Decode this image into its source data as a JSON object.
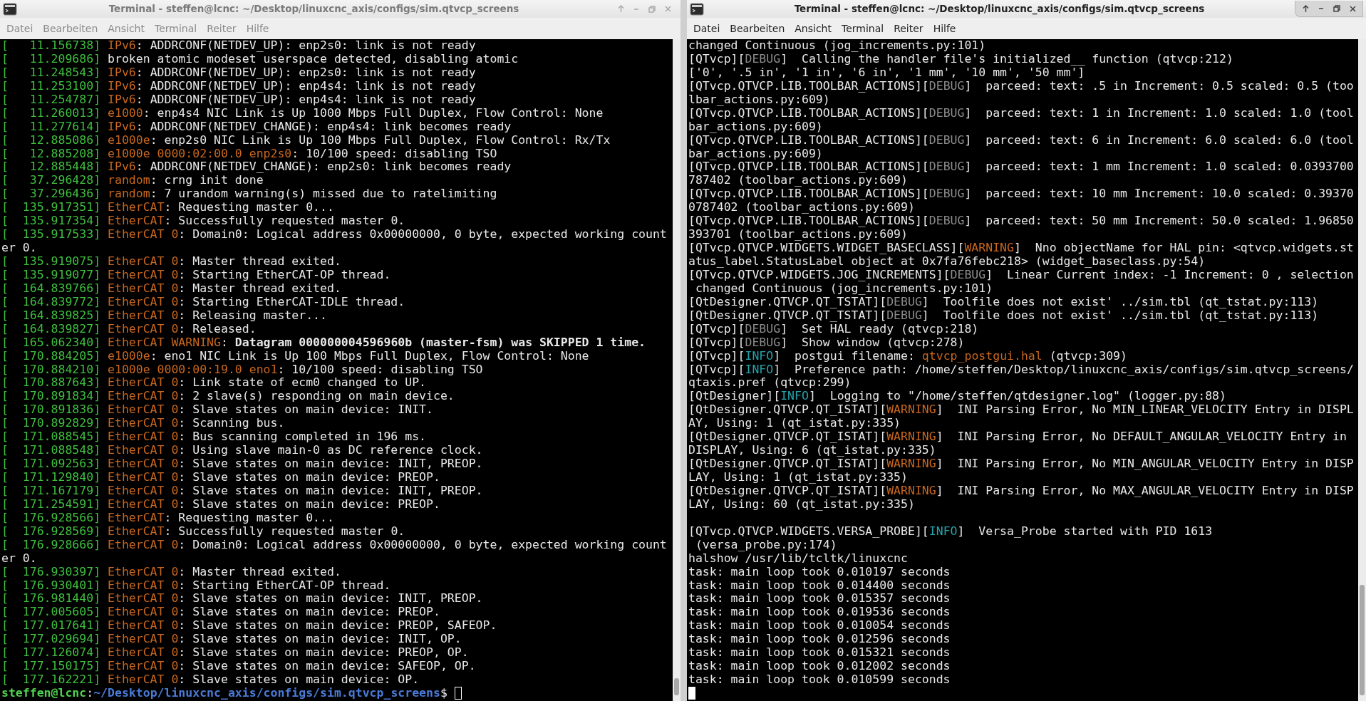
{
  "windows": [
    {
      "title": "Terminal - steffen@lcnc: ~/Desktop/linuxcnc_axis/configs/sim.qtvcp_screens",
      "active": false,
      "menu": [
        "Datei",
        "Bearbeiten",
        "Ansicht",
        "Terminal",
        "Reiter",
        "Hilfe"
      ],
      "lines": [
        [
          {
            "text": "[   11.156738] ",
            "kind": "time"
          },
          {
            "text": "IPv6",
            "kind": "source"
          },
          {
            "text": ": ADDRCONF(NETDEV_UP): enp2s0: link is not ready",
            "kind": "plain"
          }
        ],
        [
          {
            "text": "[   11.209686] ",
            "kind": "time"
          },
          {
            "text": "broken atomic modeset userspace detected, disabling atomic",
            "kind": "plain"
          }
        ],
        [
          {
            "text": "[   11.248543] ",
            "kind": "time"
          },
          {
            "text": "IPv6",
            "kind": "source"
          },
          {
            "text": ": ADDRCONF(NETDEV_UP): enp2s0: link is not ready",
            "kind": "plain"
          }
        ],
        [
          {
            "text": "[   11.253100] ",
            "kind": "time"
          },
          {
            "text": "IPv6",
            "kind": "source"
          },
          {
            "text": ": ADDRCONF(NETDEV_UP): enp4s4: link is not ready",
            "kind": "plain"
          }
        ],
        [
          {
            "text": "[   11.254787] ",
            "kind": "time"
          },
          {
            "text": "IPv6",
            "kind": "source"
          },
          {
            "text": ": ADDRCONF(NETDEV_UP): enp4s4: link is not ready",
            "kind": "plain"
          }
        ],
        [
          {
            "text": "[   11.260013] ",
            "kind": "time"
          },
          {
            "text": "e1000",
            "kind": "source"
          },
          {
            "text": ": enp4s4 NIC Link is Up 1000 Mbps Full Duplex, Flow Control: None",
            "kind": "plain"
          }
        ],
        [
          {
            "text": "[   11.277614] ",
            "kind": "time"
          },
          {
            "text": "IPv6",
            "kind": "source"
          },
          {
            "text": ": ADDRCONF(NETDEV_CHANGE): enp4s4: link becomes ready",
            "kind": "plain"
          }
        ],
        [
          {
            "text": "[   12.885086] ",
            "kind": "time"
          },
          {
            "text": "e1000e",
            "kind": "source"
          },
          {
            "text": ": enp2s0 NIC Link is Up 100 Mbps Full Duplex, Flow Control: Rx/Tx",
            "kind": "plain"
          }
        ],
        [
          {
            "text": "[   12.885208] ",
            "kind": "time"
          },
          {
            "text": "e1000e 0000:02:00.0 enp2s0",
            "kind": "source"
          },
          {
            "text": ": 10/100 speed: disabling TSO",
            "kind": "plain"
          }
        ],
        [
          {
            "text": "[   12.885448] ",
            "kind": "time"
          },
          {
            "text": "IPv6",
            "kind": "source"
          },
          {
            "text": ": ADDRCONF(NETDEV_CHANGE): enp2s0: link becomes ready",
            "kind": "plain"
          }
        ],
        [
          {
            "text": "[   37.296428] ",
            "kind": "time"
          },
          {
            "text": "random",
            "kind": "source"
          },
          {
            "text": ": crng init done",
            "kind": "plain"
          }
        ],
        [
          {
            "text": "[   37.296436] ",
            "kind": "time"
          },
          {
            "text": "random",
            "kind": "source"
          },
          {
            "text": ": 7 urandom warning(s) missed due to ratelimiting",
            "kind": "plain"
          }
        ],
        [
          {
            "text": "[  135.917351] ",
            "kind": "time"
          },
          {
            "text": "EtherCAT",
            "kind": "source"
          },
          {
            "text": ": Requesting master 0...",
            "kind": "plain"
          }
        ],
        [
          {
            "text": "[  135.917354] ",
            "kind": "time"
          },
          {
            "text": "EtherCAT",
            "kind": "source"
          },
          {
            "text": ": Successfully requested master 0.",
            "kind": "plain"
          }
        ],
        [
          {
            "text": "[  135.917533] ",
            "kind": "time"
          },
          {
            "text": "EtherCAT 0",
            "kind": "source"
          },
          {
            "text": ": Domain0: Logical address 0x00000000, 0 byte, expected working count",
            "kind": "plain"
          }
        ],
        [
          {
            "text": "er 0.",
            "kind": "plain"
          }
        ],
        [
          {
            "text": "[  135.919075] ",
            "kind": "time"
          },
          {
            "text": "EtherCAT 0",
            "kind": "source"
          },
          {
            "text": ": Master thread exited.",
            "kind": "plain"
          }
        ],
        [
          {
            "text": "[  135.919077] ",
            "kind": "time"
          },
          {
            "text": "EtherCAT 0",
            "kind": "source"
          },
          {
            "text": ": Starting EtherCAT-OP thread.",
            "kind": "plain"
          }
        ],
        [
          {
            "text": "[  164.839766] ",
            "kind": "time"
          },
          {
            "text": "EtherCAT 0",
            "kind": "source"
          },
          {
            "text": ": Master thread exited.",
            "kind": "plain"
          }
        ],
        [
          {
            "text": "[  164.839772] ",
            "kind": "time"
          },
          {
            "text": "EtherCAT 0",
            "kind": "source"
          },
          {
            "text": ": Starting EtherCAT-IDLE thread.",
            "kind": "plain"
          }
        ],
        [
          {
            "text": "[  164.839825] ",
            "kind": "time"
          },
          {
            "text": "EtherCAT 0",
            "kind": "source"
          },
          {
            "text": ": Releasing master...",
            "kind": "plain"
          }
        ],
        [
          {
            "text": "[  164.839827] ",
            "kind": "time"
          },
          {
            "text": "EtherCAT 0",
            "kind": "source"
          },
          {
            "text": ": Released.",
            "kind": "plain"
          }
        ],
        [
          {
            "text": "[  165.062340] ",
            "kind": "time"
          },
          {
            "text": "EtherCAT WARNING",
            "kind": "source"
          },
          {
            "text": ": **Datagram 000000004596960b (master-fsm) was SKIPPED 1 time.**",
            "kind": "plain"
          }
        ],
        [
          {
            "text": "[  170.884205] ",
            "kind": "time"
          },
          {
            "text": "e1000e",
            "kind": "source"
          },
          {
            "text": ": eno1 NIC Link is Up 100 Mbps Full Duplex, Flow Control: None",
            "kind": "plain"
          }
        ],
        [
          {
            "text": "[  170.884210] ",
            "kind": "time"
          },
          {
            "text": "e1000e 0000:00:19.0 eno1",
            "kind": "source"
          },
          {
            "text": ": 10/100 speed: disabling TSO",
            "kind": "plain"
          }
        ],
        [
          {
            "text": "[  170.887643] ",
            "kind": "time"
          },
          {
            "text": "EtherCAT 0",
            "kind": "source"
          },
          {
            "text": ": Link state of ecm0 changed to UP.",
            "kind": "plain"
          }
        ],
        [
          {
            "text": "[  170.891834] ",
            "kind": "time"
          },
          {
            "text": "EtherCAT 0",
            "kind": "source"
          },
          {
            "text": ": 2 slave(s) responding on main device.",
            "kind": "plain"
          }
        ],
        [
          {
            "text": "[  170.891836] ",
            "kind": "time"
          },
          {
            "text": "EtherCAT 0",
            "kind": "source"
          },
          {
            "text": ": Slave states on main device: INIT.",
            "kind": "plain"
          }
        ],
        [
          {
            "text": "[  170.892829] ",
            "kind": "time"
          },
          {
            "text": "EtherCAT 0",
            "kind": "source"
          },
          {
            "text": ": Scanning bus.",
            "kind": "plain"
          }
        ],
        [
          {
            "text": "[  171.088545] ",
            "kind": "time"
          },
          {
            "text": "EtherCAT 0",
            "kind": "source"
          },
          {
            "text": ": Bus scanning completed in 196 ms.",
            "kind": "plain"
          }
        ],
        [
          {
            "text": "[  171.088548] ",
            "kind": "time"
          },
          {
            "text": "EtherCAT 0",
            "kind": "source"
          },
          {
            "text": ": Using slave main-0 as DC reference clock.",
            "kind": "plain"
          }
        ],
        [
          {
            "text": "[  171.092563] ",
            "kind": "time"
          },
          {
            "text": "EtherCAT 0",
            "kind": "source"
          },
          {
            "text": ": Slave states on main device: INIT, PREOP.",
            "kind": "plain"
          }
        ],
        [
          {
            "text": "[  171.129840] ",
            "kind": "time"
          },
          {
            "text": "EtherCAT 0",
            "kind": "source"
          },
          {
            "text": ": Slave states on main device: PREOP.",
            "kind": "plain"
          }
        ],
        [
          {
            "text": "[  171.167179] ",
            "kind": "time"
          },
          {
            "text": "EtherCAT 0",
            "kind": "source"
          },
          {
            "text": ": Slave states on main device: INIT, PREOP.",
            "kind": "plain"
          }
        ],
        [
          {
            "text": "[  171.254591] ",
            "kind": "time"
          },
          {
            "text": "EtherCAT 0",
            "kind": "source"
          },
          {
            "text": ": Slave states on main device: PREOP.",
            "kind": "plain"
          }
        ],
        [
          {
            "text": "[  176.928566] ",
            "kind": "time"
          },
          {
            "text": "EtherCAT",
            "kind": "source"
          },
          {
            "text": ": Requesting master 0...",
            "kind": "plain"
          }
        ],
        [
          {
            "text": "[  176.928569] ",
            "kind": "time"
          },
          {
            "text": "EtherCAT",
            "kind": "source"
          },
          {
            "text": ": Successfully requested master 0.",
            "kind": "plain"
          }
        ],
        [
          {
            "text": "[  176.928666] ",
            "kind": "time"
          },
          {
            "text": "EtherCAT 0",
            "kind": "source"
          },
          {
            "text": ": Domain0: Logical address 0x00000000, 0 byte, expected working count",
            "kind": "plain"
          }
        ],
        [
          {
            "text": "er 0.",
            "kind": "plain"
          }
        ],
        [
          {
            "text": "[  176.930397] ",
            "kind": "time"
          },
          {
            "text": "EtherCAT 0",
            "kind": "source"
          },
          {
            "text": ": Master thread exited.",
            "kind": "plain"
          }
        ],
        [
          {
            "text": "[  176.930401] ",
            "kind": "time"
          },
          {
            "text": "EtherCAT 0",
            "kind": "source"
          },
          {
            "text": ": Starting EtherCAT-OP thread.",
            "kind": "plain"
          }
        ],
        [
          {
            "text": "[  176.981440] ",
            "kind": "time"
          },
          {
            "text": "EtherCAT 0",
            "kind": "source"
          },
          {
            "text": ": Slave states on main device: INIT, PREOP.",
            "kind": "plain"
          }
        ],
        [
          {
            "text": "[  177.005605] ",
            "kind": "time"
          },
          {
            "text": "EtherCAT 0",
            "kind": "source"
          },
          {
            "text": ": Slave states on main device: PREOP.",
            "kind": "plain"
          }
        ],
        [
          {
            "text": "[  177.017641] ",
            "kind": "time"
          },
          {
            "text": "EtherCAT 0",
            "kind": "source"
          },
          {
            "text": ": Slave states on main device: PREOP, SAFEOP.",
            "kind": "plain"
          }
        ],
        [
          {
            "text": "[  177.029694] ",
            "kind": "time"
          },
          {
            "text": "EtherCAT 0",
            "kind": "source"
          },
          {
            "text": ": Slave states on main device: INIT, OP.",
            "kind": "plain"
          }
        ],
        [
          {
            "text": "[  177.126074] ",
            "kind": "time"
          },
          {
            "text": "EtherCAT 0",
            "kind": "source"
          },
          {
            "text": ": Slave states on main device: PREOP, OP.",
            "kind": "plain"
          }
        ],
        [
          {
            "text": "[  177.150175] ",
            "kind": "time"
          },
          {
            "text": "EtherCAT 0",
            "kind": "source"
          },
          {
            "text": ": Slave states on main device: SAFEOP, OP.",
            "kind": "plain"
          }
        ],
        [
          {
            "text": "[  177.162221] ",
            "kind": "time"
          },
          {
            "text": "EtherCAT 0",
            "kind": "source"
          },
          {
            "text": ": Slave states on main device: OP.",
            "kind": "plain"
          }
        ]
      ],
      "prompt": [
        {
          "text": "steffen@lcnc",
          "kind": "user"
        },
        {
          "text": ":",
          "kind": "plain"
        },
        {
          "text": "~/Desktop/linuxcnc_axis/configs/sim.qtvcp_screens",
          "kind": "path"
        },
        {
          "text": "$",
          "kind": "plain"
        }
      ]
    },
    {
      "title": "Terminal - steffen@lcnc: ~/Desktop/linuxcnc_axis/configs/sim.qtvcp_screens",
      "active": true,
      "menu": [
        "Datei",
        "Bearbeiten",
        "Ansicht",
        "Terminal",
        "Reiter",
        "Hilfe"
      ],
      "lines": [
        [
          {
            "text": "changed Continuous (jog_increments.py:101)",
            "kind": "plain"
          }
        ],
        [
          {
            "text": "[QTvcp][",
            "kind": "plain"
          },
          {
            "text": "DEBUG",
            "kind": "debug"
          },
          {
            "text": "]  Calling the handler file's initialized__ function (qtvcp:212)",
            "kind": "plain"
          }
        ],
        [
          {
            "text": "['0', '.5 in', '1 in', '6 in', '1 mm', '10 mm', '50 mm']",
            "kind": "plain"
          }
        ],
        [
          {
            "text": "[QTvcp.QTVCP.LIB.TOOLBAR_ACTIONS][",
            "kind": "plain"
          },
          {
            "text": "DEBUG",
            "kind": "debug"
          },
          {
            "text": "]  parceed: text: .5 in Increment: 0.5 scaled: 0.5 (too",
            "kind": "plain"
          }
        ],
        [
          {
            "text": "lbar_actions.py:609)",
            "kind": "plain"
          }
        ],
        [
          {
            "text": "[QTvcp.QTVCP.LIB.TOOLBAR_ACTIONS][",
            "kind": "plain"
          },
          {
            "text": "DEBUG",
            "kind": "debug"
          },
          {
            "text": "]  parceed: text: 1 in Increment: 1.0 scaled: 1.0 (tool",
            "kind": "plain"
          }
        ],
        [
          {
            "text": "bar_actions.py:609)",
            "kind": "plain"
          }
        ],
        [
          {
            "text": "[QTvcp.QTVCP.LIB.TOOLBAR_ACTIONS][",
            "kind": "plain"
          },
          {
            "text": "DEBUG",
            "kind": "debug"
          },
          {
            "text": "]  parceed: text: 6 in Increment: 6.0 scaled: 6.0 (tool",
            "kind": "plain"
          }
        ],
        [
          {
            "text": "bar_actions.py:609)",
            "kind": "plain"
          }
        ],
        [
          {
            "text": "[QTvcp.QTVCP.LIB.TOOLBAR_ACTIONS][",
            "kind": "plain"
          },
          {
            "text": "DEBUG",
            "kind": "debug"
          },
          {
            "text": "]  parceed: text: 1 mm Increment: 1.0 scaled: 0.0393700",
            "kind": "plain"
          }
        ],
        [
          {
            "text": "787402 (toolbar_actions.py:609)",
            "kind": "plain"
          }
        ],
        [
          {
            "text": "[QTvcp.QTVCP.LIB.TOOLBAR_ACTIONS][",
            "kind": "plain"
          },
          {
            "text": "DEBUG",
            "kind": "debug"
          },
          {
            "text": "]  parceed: text: 10 mm Increment: 10.0 scaled: 0.39370",
            "kind": "plain"
          }
        ],
        [
          {
            "text": "0787402 (toolbar_actions.py:609)",
            "kind": "plain"
          }
        ],
        [
          {
            "text": "[QTvcp.QTVCP.LIB.TOOLBAR_ACTIONS][",
            "kind": "plain"
          },
          {
            "text": "DEBUG",
            "kind": "debug"
          },
          {
            "text": "]  parceed: text: 50 mm Increment: 50.0 scaled: 1.96850",
            "kind": "plain"
          }
        ],
        [
          {
            "text": "393701 (toolbar_actions.py:609)",
            "kind": "plain"
          }
        ],
        [
          {
            "text": "[QTvcp.QTVCP.WIDGETS.WIDGET_BASECLASS][",
            "kind": "plain"
          },
          {
            "text": "WARNING",
            "kind": "warning"
          },
          {
            "text": "]  Nno objectName for HAL pin: <qtvcp.widgets.st",
            "kind": "plain"
          }
        ],
        [
          {
            "text": "atus_label.StatusLabel object at 0x7fa76febc218> (widget_baseclass.py:54)",
            "kind": "plain"
          }
        ],
        [
          {
            "text": "[QTvcp.QTVCP.WIDGETS.JOG_INCREMENTS][",
            "kind": "plain"
          },
          {
            "text": "DEBUG",
            "kind": "debug"
          },
          {
            "text": "]  Linear Current index: -1 Increment: 0 , selection",
            "kind": "plain"
          }
        ],
        [
          {
            "text": " changed Continuous (jog_increments.py:101)",
            "kind": "plain"
          }
        ],
        [
          {
            "text": "[QtDesigner.QTVCP.QT_TSTAT][",
            "kind": "plain"
          },
          {
            "text": "DEBUG",
            "kind": "debug"
          },
          {
            "text": "]  Toolfile does not exist' ../sim.tbl (qt_tstat.py:113)",
            "kind": "plain"
          }
        ],
        [
          {
            "text": "[QtDesigner.QTVCP.QT_TSTAT][",
            "kind": "plain"
          },
          {
            "text": "DEBUG",
            "kind": "debug"
          },
          {
            "text": "]  Toolfile does not exist' ../sim.tbl (qt_tstat.py:113)",
            "kind": "plain"
          }
        ],
        [
          {
            "text": "[QTvcp][",
            "kind": "plain"
          },
          {
            "text": "DEBUG",
            "kind": "debug"
          },
          {
            "text": "]  Set HAL ready (qtvcp:218)",
            "kind": "plain"
          }
        ],
        [
          {
            "text": "[QTvcp][",
            "kind": "plain"
          },
          {
            "text": "DEBUG",
            "kind": "debug"
          },
          {
            "text": "]  Show window (qtvcp:278)",
            "kind": "plain"
          }
        ],
        [
          {
            "text": "[QTvcp][",
            "kind": "plain"
          },
          {
            "text": "INFO",
            "kind": "info"
          },
          {
            "text": "]  postgui filename: ",
            "kind": "plain"
          },
          {
            "text": "qtvcp_postgui.hal",
            "kind": "source"
          },
          {
            "text": " (qtvcp:309)",
            "kind": "plain"
          }
        ],
        [
          {
            "text": "[QTvcp][",
            "kind": "plain"
          },
          {
            "text": "INFO",
            "kind": "info"
          },
          {
            "text": "]  Preference path: /home/steffen/Desktop/linuxcnc_axis/configs/sim.qtvcp_screens/",
            "kind": "plain"
          }
        ],
        [
          {
            "text": "qtaxis.pref (qtvcp:299)",
            "kind": "plain"
          }
        ],
        [
          {
            "text": "[QtDesigner][",
            "kind": "plain"
          },
          {
            "text": "INFO",
            "kind": "info"
          },
          {
            "text": "]  Logging to \"/home/steffen/qtdesigner.log\" (logger.py:88)",
            "kind": "plain"
          }
        ],
        [
          {
            "text": "[QtDesigner.QTVCP.QT_ISTAT][",
            "kind": "plain"
          },
          {
            "text": "WARNING",
            "kind": "warning"
          },
          {
            "text": "]  INI Parsing Error, No MIN_LINEAR_VELOCITY Entry in DISPL",
            "kind": "plain"
          }
        ],
        [
          {
            "text": "AY, Using: 1 (qt_istat.py:335)",
            "kind": "plain"
          }
        ],
        [
          {
            "text": "[QtDesigner.QTVCP.QT_ISTAT][",
            "kind": "plain"
          },
          {
            "text": "WARNING",
            "kind": "warning"
          },
          {
            "text": "]  INI Parsing Error, No DEFAULT_ANGULAR_VELOCITY Entry in",
            "kind": "plain"
          }
        ],
        [
          {
            "text": "DISPLAY, Using: 6 (qt_istat.py:335)",
            "kind": "plain"
          }
        ],
        [
          {
            "text": "[QtDesigner.QTVCP.QT_ISTAT][",
            "kind": "plain"
          },
          {
            "text": "WARNING",
            "kind": "warning"
          },
          {
            "text": "]  INI Parsing Error, No MIN_ANGULAR_VELOCITY Entry in DISP",
            "kind": "plain"
          }
        ],
        [
          {
            "text": "LAY, Using: 1 (qt_istat.py:335)",
            "kind": "plain"
          }
        ],
        [
          {
            "text": "[QtDesigner.QTVCP.QT_ISTAT][",
            "kind": "plain"
          },
          {
            "text": "WARNING",
            "kind": "warning"
          },
          {
            "text": "]  INI Parsing Error, No MAX_ANGULAR_VELOCITY Entry in DISP",
            "kind": "plain"
          }
        ],
        [
          {
            "text": "LAY, Using: 60 (qt_istat.py:335)",
            "kind": "plain"
          }
        ],
        [
          {
            "text": "[QTvcp.QTVCP.WIDGETS.VERSA_PROBE][",
            "kind": "plain",
            "blank_before": true
          },
          {
            "text": "INFO",
            "kind": "info"
          },
          {
            "text": "]  Versa_Probe started with PID 1613",
            "kind": "plain"
          }
        ],
        [
          {
            "text": " (versa_probe.py:174)",
            "kind": "plain"
          }
        ],
        [
          {
            "text": "halshow /usr/lib/tcltk/linuxcnc",
            "kind": "plain"
          }
        ],
        [
          {
            "text": "task: main loop took 0.010197 seconds",
            "kind": "plain"
          }
        ],
        [
          {
            "text": "task: main loop took 0.014400 seconds",
            "kind": "plain"
          }
        ],
        [
          {
            "text": "task: main loop took 0.015357 seconds",
            "kind": "plain"
          }
        ],
        [
          {
            "text": "task: main loop took 0.019536 seconds",
            "kind": "plain"
          }
        ],
        [
          {
            "text": "task: main loop took 0.010054 seconds",
            "kind": "plain"
          }
        ],
        [
          {
            "text": "task: main loop took 0.012596 seconds",
            "kind": "plain"
          }
        ],
        [
          {
            "text": "task: main loop took 0.015321 seconds",
            "kind": "plain"
          }
        ],
        [
          {
            "text": "task: main loop took 0.012002 seconds",
            "kind": "plain"
          }
        ],
        [
          {
            "text": "task: main loop took 0.010599 seconds",
            "kind": "plain"
          }
        ]
      ]
    }
  ]
}
